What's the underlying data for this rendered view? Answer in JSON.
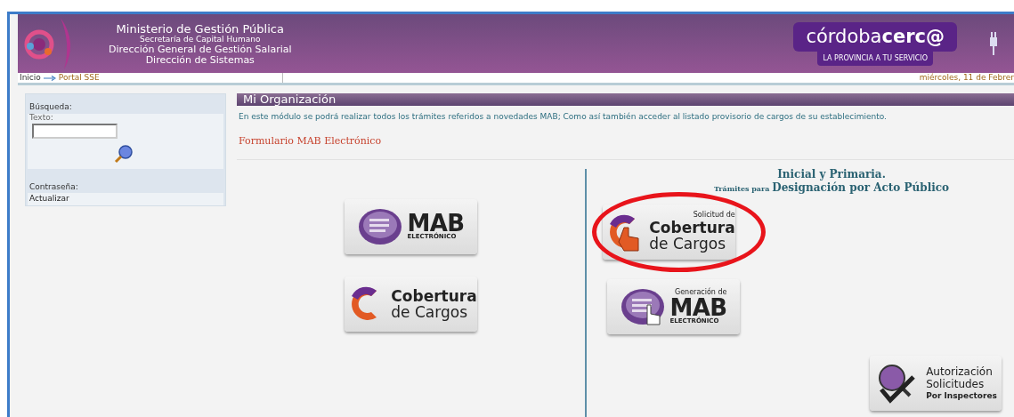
{
  "header": {
    "title": "Ministerio de Gestión Pública",
    "lines": [
      "Secretaría de Capital Humano",
      "Dirección General de Gestión Salarial",
      "Dirección de Sistemas"
    ],
    "brand": {
      "light": "córdoba",
      "bold": "cerc@",
      "tagline": "LA PROVINCIA A TU SERVICIO"
    }
  },
  "breadcrumb": {
    "items": [
      "Inicio",
      "Portal SSE"
    ],
    "date": "miércoles, 11 de Febrer"
  },
  "sidebar": {
    "search_title": "Búsqueda:",
    "field_label": "Texto:",
    "password_title": "Contraseña:",
    "password_link": "Actualizar"
  },
  "main": {
    "title": "Mi Organización",
    "description": "En este módulo se podrá realizar todos los trámites referidos a novedades MAB; Como así también acceder al listado provisorio de cargos de su establecimiento.",
    "link": "Formulario MAB Electrónico",
    "right_heading": "Inicial y Primaria.",
    "right_prefix": "Trámites para",
    "right_subheading": "Designación por Acto Público",
    "left_tiles": [
      {
        "kind": "mab",
        "big": "MAB",
        "small": "ELECTRÓNICO",
        "highlighted": false
      },
      {
        "kind": "cobertura",
        "big": "Cobertura",
        "small": "de Cargos",
        "highlighted": false
      }
    ],
    "right_tiles": [
      {
        "kind": "cobertura_hand",
        "top": "Solicitud de",
        "big": "Cobertura",
        "small": "de Cargos",
        "highlighted": true
      },
      {
        "kind": "mab_hand",
        "top": "Generación de",
        "big": "MAB",
        "small": "ELECTRÓNICO",
        "highlighted": false
      }
    ],
    "corner_tile": {
      "kind": "autorizacion",
      "top": "Autorización",
      "big": "Solicitudes",
      "small": "Por Inspectores",
      "highlighted": false
    }
  }
}
